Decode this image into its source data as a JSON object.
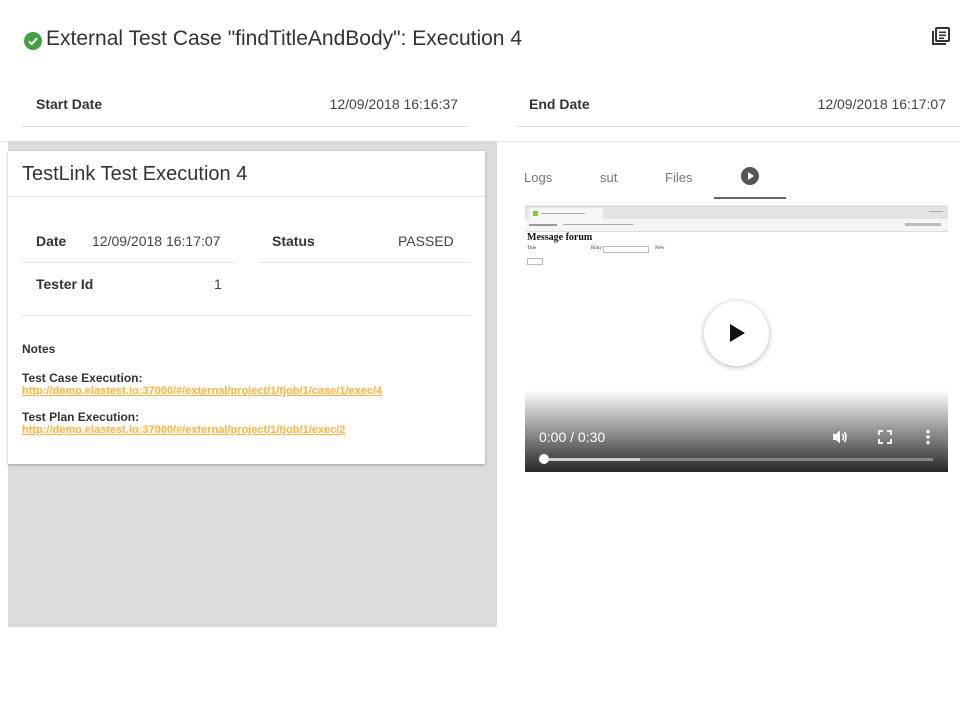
{
  "header": {
    "title": "External Test Case \"findTitleAndBody\": Execution 4",
    "status_icon": "check-circle-icon",
    "action_icon": "document-icon"
  },
  "dates": {
    "start_label": "Start Date",
    "start_value": "12/09/2018 16:16:37",
    "end_label": "End Date",
    "end_value": "12/09/2018 16:17:07"
  },
  "card": {
    "title": "TestLink Test Execution 4",
    "date_label": "Date",
    "date_value": "12/09/2018 16:17:07",
    "status_label": "Status",
    "status_value": "PASSED",
    "tester_label": "Tester Id",
    "tester_value": "1",
    "notes_label": "Notes",
    "case_exec_label": "Test Case Execution:",
    "case_exec_link": "http://demo.elastest.io:37000/#/external/project/1/tjob/1/case/1/exec/4",
    "plan_exec_label": "Test Plan Execution:",
    "plan_exec_link": "http://demo.elastest.io:37000/#/external/project/1/tjob/1/exec/2"
  },
  "tabs": [
    {
      "label": "Logs"
    },
    {
      "label": "sut"
    },
    {
      "label": "Files"
    },
    {
      "icon": "play-circle-icon",
      "active": true
    }
  ],
  "video": {
    "page_heading": "Message forum",
    "field_title": "Title",
    "field_body": "Body",
    "button_new": "New",
    "time": "0:00 / 0:30",
    "progress": 0,
    "buffered": 0.25,
    "icons": [
      "volume-icon",
      "fullscreen-icon",
      "more-vert-icon"
    ]
  },
  "colors": {
    "success": "#43a047",
    "link": "#ffb138",
    "panel_bg": "#dcdcdc"
  }
}
